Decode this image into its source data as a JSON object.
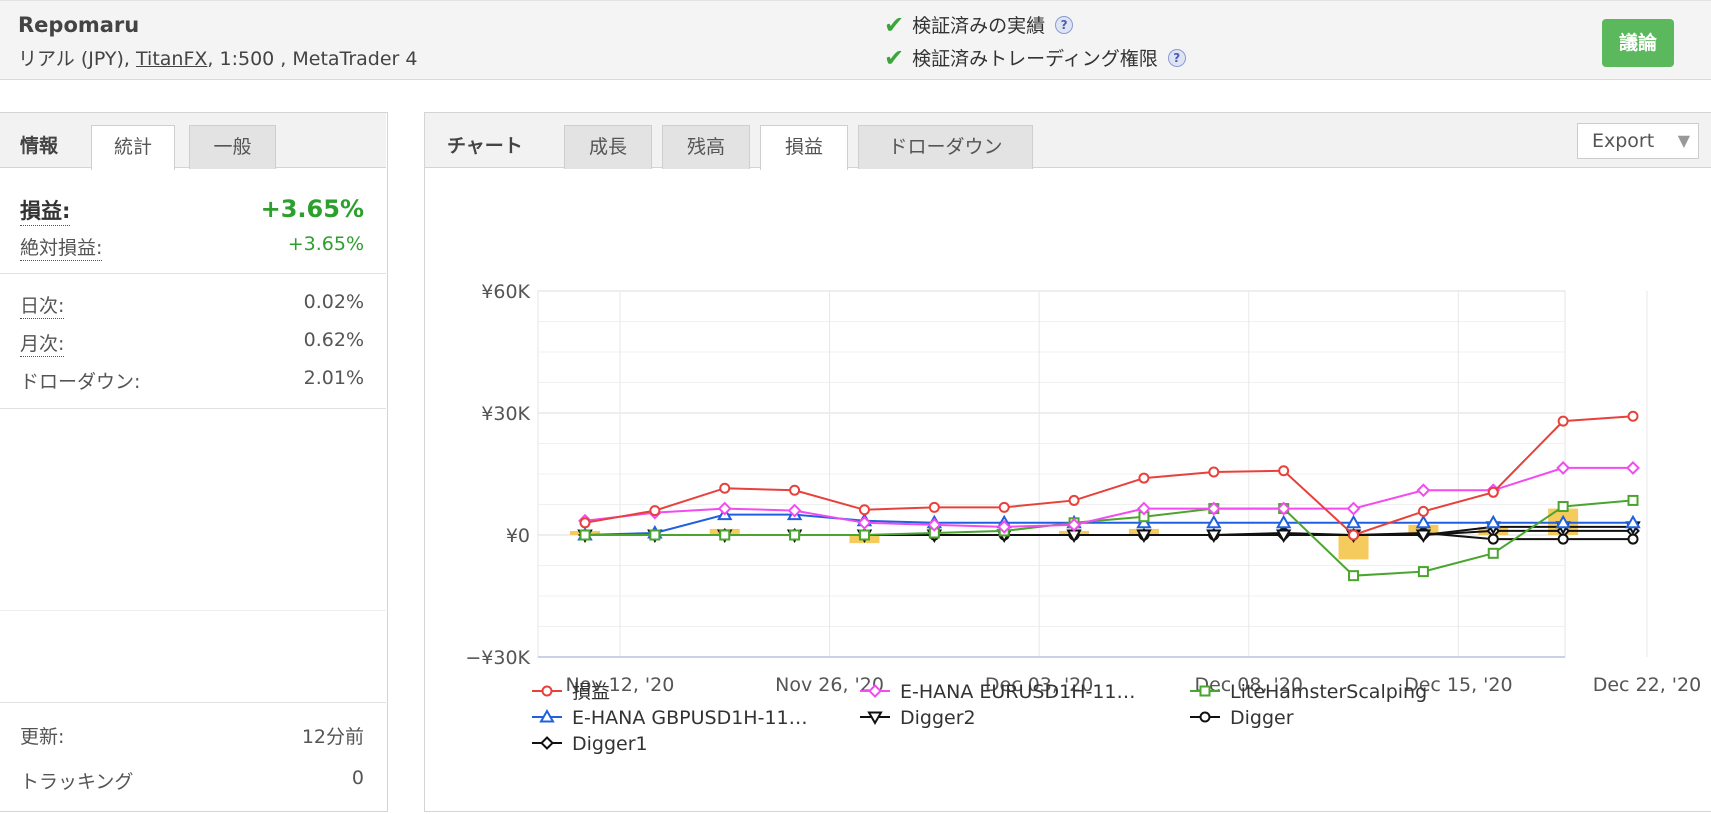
{
  "header": {
    "account_name": "Repomaru",
    "account_type": "リアル (JPY), ",
    "broker": "TitanFX",
    "account_rest": ", 1:500 , MetaTrader 4",
    "verified_track_record": "検証済みの実績",
    "verified_trading_privileges": "検証済みトレーディング権限",
    "help_glyph": "?",
    "discuss_button": "議論"
  },
  "left_panel": {
    "title": "情報",
    "tabs": [
      "統計",
      "一般"
    ],
    "stats": {
      "gain_label": "損益:",
      "gain_value": "+3.65%",
      "abs_gain_label": "絶対損益:",
      "abs_gain_value": "+3.65%",
      "daily_label": "日次:",
      "daily_value": "0.02%",
      "monthly_label": "月次:",
      "monthly_value": "0.62%",
      "drawdown_label": "ドローダウン:",
      "drawdown_value": "2.01%"
    },
    "footer": {
      "updated_label": "更新:",
      "updated_value": "12分前",
      "tracking_label": "トラッキング",
      "tracking_value": "0"
    }
  },
  "chart_panel": {
    "title": "チャート",
    "tabs": [
      "成長",
      "残高",
      "損益",
      "ドローダウン"
    ],
    "active_tab": "損益",
    "export_label": "Export",
    "export_arrow": "▼"
  },
  "chart_data": {
    "type": "line",
    "y_ticks": [
      "¥60K",
      "¥30K",
      "¥0",
      "−¥30K"
    ],
    "ylim": [
      -30000,
      60000
    ],
    "x_tick_labels": [
      "Nov 12, '20",
      "Nov 26, '20",
      "Dec 03, '20",
      "Dec 08, '20",
      "Dec 15, '20",
      "Dec 22, '20"
    ],
    "x_tick_index": [
      0.5,
      3.5,
      6.5,
      9.5,
      12.5,
      15.2
    ],
    "grid": true,
    "legend_position": "bottom",
    "bar_series": {
      "name": "",
      "color": "#f5c242",
      "values": [
        1000,
        0,
        1500,
        0,
        -2000,
        0,
        0,
        1000,
        1500,
        0,
        0,
        -6000,
        2500,
        2000,
        6500,
        0
      ]
    },
    "series": [
      {
        "name": "損益",
        "color": "#e8413c",
        "marker": "circle",
        "values": [
          3000,
          6000,
          11500,
          11000,
          6200,
          6800,
          6800,
          8500,
          14000,
          15500,
          15800,
          0,
          5800,
          10500,
          28000,
          29200
        ]
      },
      {
        "name": "E-HANA EURUSD1H-11…",
        "color": "#f24cf0",
        "marker": "diamond",
        "values": [
          3500,
          5500,
          6500,
          6000,
          3000,
          2500,
          2000,
          2500,
          6500,
          6500,
          6500,
          6500,
          11000,
          11000,
          16500,
          16500
        ]
      },
      {
        "name": "LiteHamsterScalping",
        "color": "#4aa52e",
        "marker": "square",
        "values": [
          0,
          0,
          0,
          0,
          0,
          500,
          1000,
          3000,
          4500,
          6500,
          6500,
          -10000,
          -9000,
          -4500,
          7000,
          8500
        ]
      },
      {
        "name": "E-HANA GBPUSD1H-11…",
        "color": "#2060e0",
        "marker": "triangle",
        "values": [
          0,
          500,
          5000,
          5000,
          3500,
          3000,
          3000,
          3000,
          3000,
          3000,
          3000,
          3000,
          3000,
          3000,
          3000,
          3000
        ]
      },
      {
        "name": "Digger2",
        "color": "#111111",
        "marker": "triangle-down",
        "values": [
          0,
          0,
          0,
          0,
          0,
          0,
          0,
          0,
          0,
          0,
          0,
          0,
          0,
          2000,
          2000,
          2000
        ]
      },
      {
        "name": "Digger",
        "color": "#111111",
        "marker": "circle",
        "values": [
          0,
          0,
          0,
          0,
          0,
          0,
          0,
          0,
          0,
          0,
          500,
          0,
          500,
          -1000,
          -1000,
          -1000
        ]
      },
      {
        "name": "Digger1",
        "color": "#111111",
        "marker": "diamond",
        "values": [
          0,
          0,
          0,
          0,
          0,
          0,
          0,
          0,
          0,
          0,
          0,
          0,
          0,
          1000,
          1000,
          1000
        ]
      }
    ]
  }
}
